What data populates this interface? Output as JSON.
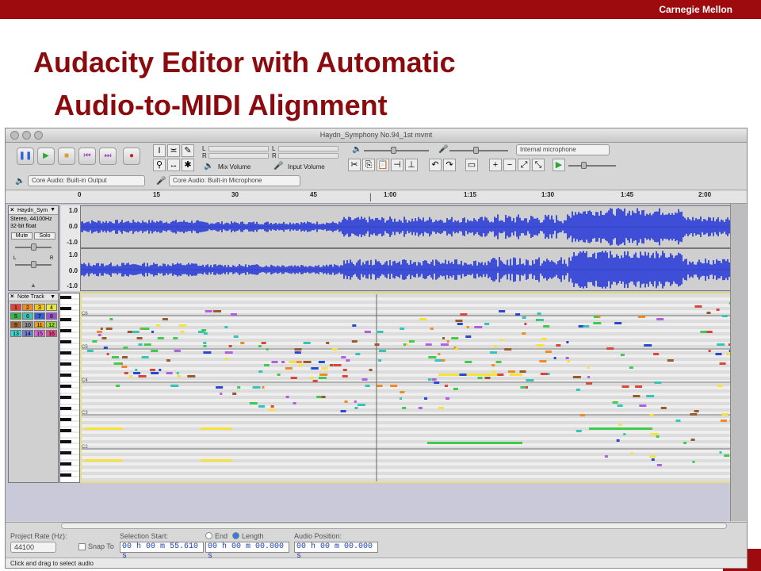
{
  "slide": {
    "brand": "Carnegie Mellon",
    "title_line1": "Audacity Editor with Automatic",
    "title_line2": "Audio-to-MIDI Alignment"
  },
  "window": {
    "title": "Haydn_Symphony No.94_1st mvmt"
  },
  "toolbar": {
    "mix_volume_label": "Mix Volume",
    "input_volume_label": "Input Volume",
    "input_device": "Internal microphone",
    "playback_device": "Core Audio: Built-in Output",
    "recording_device": "Core Audio: Built-in Microphone",
    "meter_l": "L",
    "meter_r": "R"
  },
  "ruler": {
    "ticks": [
      "0",
      "15",
      "30",
      "45",
      "1:00",
      "1:15",
      "1:30",
      "1:45",
      "2:00"
    ]
  },
  "audio_track": {
    "name": "Haydn_Sym",
    "format_line1": "Stereo, 44100Hz",
    "format_line2": "32-bit float",
    "mute_label": "Mute",
    "solo_label": "Solo",
    "pan_l": "L",
    "pan_r": "R",
    "scale": [
      "1.0",
      "0.0",
      "-1.0",
      "1.0",
      "0.0",
      "-1.0"
    ]
  },
  "note_track": {
    "name": "Note Track",
    "channels": [
      "1",
      "2",
      "3",
      "4",
      "5",
      "6",
      "7",
      "8",
      "9",
      "10",
      "11",
      "12",
      "13",
      "14",
      "15",
      "16"
    ],
    "channel_colors": [
      "#e3413c",
      "#f08a24",
      "#f2c318",
      "#e8e83c",
      "#3ab54a",
      "#35c4b7",
      "#2e5fd6",
      "#9b4fd6",
      "#a0622a",
      "#8d8d8d",
      "#e8a020",
      "#9fd63c",
      "#3cd6d6",
      "#6a7fd6",
      "#d66ad6",
      "#e64a8a"
    ],
    "octave_markers": [
      "C6",
      "C5",
      "C4",
      "C3",
      "C2"
    ],
    "note_colors": {
      "red": "#d9463a",
      "orange": "#ef8a25",
      "purple": "#b05fe0",
      "blue": "#2848d0",
      "green": "#3fcc4e",
      "yellow": "#f5e23a",
      "brown": "#9a5b2c",
      "teal": "#35c4b7"
    }
  },
  "status": {
    "project_rate_label": "Project Rate (Hz):",
    "project_rate": "44100",
    "snap_to_label": "Snap To",
    "selection_start_label": "Selection Start:",
    "end_label": "End",
    "length_label": "Length",
    "audio_position_label": "Audio Position:",
    "selection_start": "00 h 00 m 55.610 s",
    "length": "00 h 00 m 00.000 s",
    "audio_position": "00 h 00 m 00.000 s",
    "hint": "Click and drag to select audio"
  }
}
